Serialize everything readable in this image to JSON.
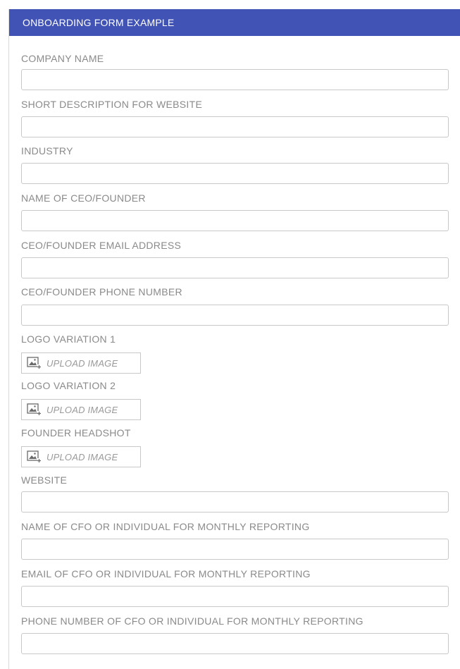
{
  "header": {
    "title": "ONBOARDING FORM EXAMPLE"
  },
  "colors": {
    "header_bg": "#4153b5",
    "label": "#8a8a8a",
    "border": "#c8c8c8"
  },
  "fields": [
    {
      "label": "COMPANY NAME",
      "value": ""
    },
    {
      "label": "SHORT DESCRIPTION FOR WEBSITE",
      "value": ""
    },
    {
      "label": "INDUSTRY",
      "value": ""
    },
    {
      "label": "NAME OF CEO/FOUNDER",
      "value": ""
    },
    {
      "label": "CEO/FOUNDER EMAIL ADDRESS",
      "value": ""
    },
    {
      "label": "CEO/FOUNDER PHONE NUMBER",
      "value": ""
    }
  ],
  "uploads": [
    {
      "label": "LOGO VARIATION 1",
      "button_label": "UPLOAD IMAGE",
      "icon": "upload-image-icon"
    },
    {
      "label": "LOGO VARIATION 2",
      "button_label": "UPLOAD IMAGE",
      "icon": "upload-image-icon"
    },
    {
      "label": "FOUNDER HEADSHOT",
      "button_label": "UPLOAD IMAGE",
      "icon": "upload-image-icon"
    }
  ],
  "fields_after": [
    {
      "label": "WEBSITE",
      "value": ""
    },
    {
      "label": "NAME OF CFO OR INDIVIDUAL FOR MONTHLY REPORTING",
      "value": ""
    },
    {
      "label": "EMAIL OF CFO OR INDIVIDUAL FOR MONTHLY REPORTING",
      "value": ""
    },
    {
      "label": "PHONE NUMBER OF CFO OR INDIVIDUAL FOR MONTHLY REPORTING",
      "value": ""
    }
  ]
}
